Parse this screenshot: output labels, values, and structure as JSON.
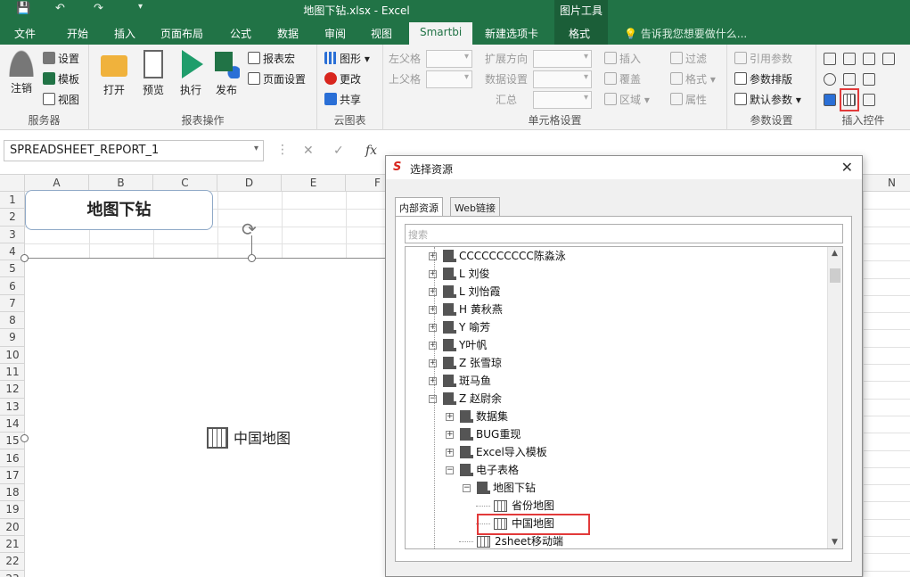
{
  "window": {
    "title": "地图下钻.xlsx - Excel",
    "context_tool": "图片工具"
  },
  "tabs": [
    "文件",
    "开始",
    "插入",
    "页面布局",
    "公式",
    "数据",
    "审阅",
    "视图",
    "Smartbi",
    "新建选项卡",
    "格式"
  ],
  "active_tab": "Smartbi",
  "tell_me": "告诉我您想要做什么...",
  "ribbon": {
    "server": {
      "label": "服务器",
      "logout": "注销",
      "settings": "设置",
      "template": "模板",
      "view": "视图"
    },
    "report_ops": {
      "label": "报表操作",
      "open": "打开",
      "preview": "预览",
      "execute": "执行",
      "publish": "发布",
      "report_macro": "报表宏",
      "page_setup": "页面设置"
    },
    "cloud_chart": {
      "label": "云图表",
      "chart": "图形",
      "update": "更改",
      "share": "共享"
    },
    "cell_settings": {
      "label": "单元格设置",
      "left_parent": "左父格",
      "top_parent": "上父格",
      "expand_dir": "扩展方向",
      "data_settings": "数据设置",
      "summary": "汇总",
      "insert": "插入",
      "cover": "覆盖",
      "region": "区域",
      "filter": "过滤",
      "format": "格式",
      "property": "属性"
    },
    "param_settings": {
      "label": "参数设置",
      "ref_param": "引用参数",
      "param_layout": "参数排版",
      "default_param": "默认参数"
    },
    "insert_ctrl": {
      "label": "插入控件"
    }
  },
  "formula_bar": {
    "name_box": "SPREADSHEET_REPORT_1",
    "fx": "fx"
  },
  "sheet": {
    "columns": [
      "A",
      "B",
      "C",
      "D",
      "E",
      "F",
      "N"
    ],
    "rows": [
      "1",
      "2",
      "3",
      "4",
      "5",
      "6",
      "7",
      "8",
      "9",
      "10",
      "11",
      "12",
      "13",
      "14",
      "15",
      "16",
      "17",
      "18",
      "19",
      "20",
      "21",
      "22",
      "23"
    ],
    "title_box": "地图下钻",
    "map_label": "中国地图"
  },
  "dialog": {
    "title": "选择资源",
    "tab_internal": "内部资源",
    "tab_web": "Web链接",
    "search_placeholder": "搜索",
    "tree": [
      {
        "label": "CCCCCCCCCC陈淼泳",
        "level": 0,
        "expander": "+",
        "icon": "folder"
      },
      {
        "label": "L 刘俊",
        "level": 0,
        "expander": "+",
        "icon": "folder"
      },
      {
        "label": "L 刘怡霞",
        "level": 0,
        "expander": "+",
        "icon": "folder"
      },
      {
        "label": "H 黄秋燕",
        "level": 0,
        "expander": "+",
        "icon": "folder"
      },
      {
        "label": "Y 喻芳",
        "level": 0,
        "expander": "+",
        "icon": "folder"
      },
      {
        "label": "Y叶帆",
        "level": 0,
        "expander": "+",
        "icon": "folder"
      },
      {
        "label": "Z 张雪琼",
        "level": 0,
        "expander": "+",
        "icon": "folder"
      },
      {
        "label": "斑马鱼",
        "level": 0,
        "expander": "+",
        "icon": "folder"
      },
      {
        "label": "Z 赵尉余",
        "level": 0,
        "expander": "−",
        "icon": "folder"
      },
      {
        "label": "数据集",
        "level": 1,
        "expander": "+",
        "icon": "folder"
      },
      {
        "label": "BUG重现",
        "level": 1,
        "expander": "+",
        "icon": "folder"
      },
      {
        "label": "Excel导入模板",
        "level": 1,
        "expander": "+",
        "icon": "folder"
      },
      {
        "label": "电子表格",
        "level": 1,
        "expander": "−",
        "icon": "folder"
      },
      {
        "label": "地图下钻",
        "level": 2,
        "expander": "−",
        "icon": "folder"
      },
      {
        "label": "省份地图",
        "level": 3,
        "expander": "",
        "icon": "report"
      },
      {
        "label": "中国地图",
        "level": 3,
        "expander": "",
        "icon": "report",
        "selected": true
      },
      {
        "label": "2sheet移动端",
        "level": 2,
        "expander": "",
        "icon": "report"
      }
    ]
  },
  "colors": {
    "excel_green": "#217346",
    "highlight_red": "#e23a3a",
    "smartbi_red": "#d8261e"
  }
}
